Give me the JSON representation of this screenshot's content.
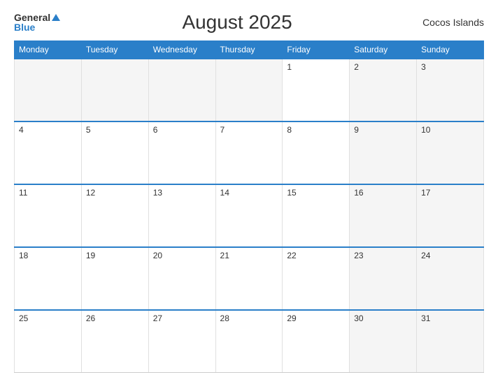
{
  "header": {
    "logo_general": "General",
    "logo_blue": "Blue",
    "title": "August 2025",
    "region": "Cocos Islands"
  },
  "calendar": {
    "days_of_week": [
      "Monday",
      "Tuesday",
      "Wednesday",
      "Thursday",
      "Friday",
      "Saturday",
      "Sunday"
    ],
    "weeks": [
      [
        "",
        "",
        "",
        "",
        "1",
        "2",
        "3"
      ],
      [
        "4",
        "5",
        "6",
        "7",
        "8",
        "9",
        "10"
      ],
      [
        "11",
        "12",
        "13",
        "14",
        "15",
        "16",
        "17"
      ],
      [
        "18",
        "19",
        "20",
        "21",
        "22",
        "23",
        "24"
      ],
      [
        "25",
        "26",
        "27",
        "28",
        "29",
        "30",
        "31"
      ]
    ]
  }
}
